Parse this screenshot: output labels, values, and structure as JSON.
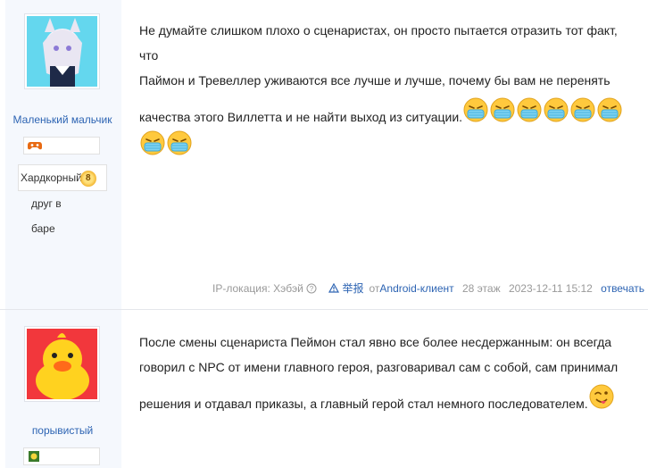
{
  "posts": [
    {
      "username": "Маленький мальчик",
      "level_title": "Хардкорный",
      "level_num": "8",
      "title_line1": "друг в",
      "title_line2": "баре",
      "text_line1": "Не думайте слишком плохо о сценаристах, он просто пытается отразить тот факт, что",
      "text_line2": "Паймон и Тревеллер уживаются все лучше и лучше, почему бы вам не перенять",
      "text_line3": "качества этого Виллетта и не найти выход из ситуации.",
      "emoji_icon": "sick-mask-emoji",
      "tail": {
        "ip": "IP-локация: Хэбэй",
        "report": "举报",
        "from_prefix": "от",
        "client": "Android-клиент",
        "floor": "28 этаж",
        "datetime": "2023-12-11 15:12",
        "reply": "отвечать"
      }
    },
    {
      "username": "порывистый",
      "text_line1": "После смены сценариста Пеймон стал явно все более несдержанным: он всегда",
      "text_line2": "говорил с NPC от имени главного героя, разговаривал сам с собой, сам принимал",
      "text_line3": "решения и отдавал приказы, а главный герой стал немного последователем.",
      "emoji_icon": "tongue-out-emoji"
    }
  ],
  "colors": {
    "link": "#2d64b3",
    "sidebar_bg": "#f5f8fd",
    "meta": "#999999"
  }
}
